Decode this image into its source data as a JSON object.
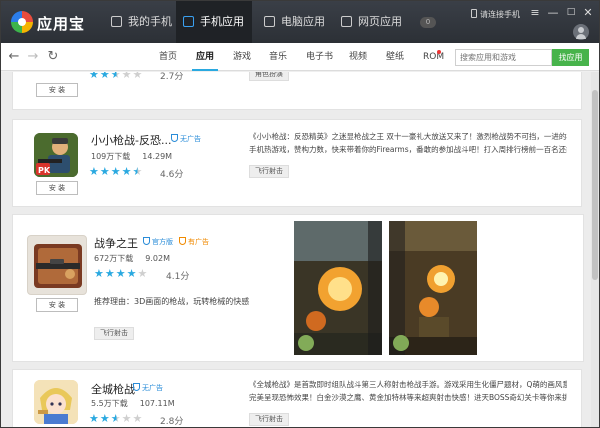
{
  "app": {
    "name": "应用宝"
  },
  "nav": {
    "tabs": [
      {
        "label": "我的手机"
      },
      {
        "label": "手机应用"
      },
      {
        "label": "电脑应用"
      },
      {
        "label": "网页应用"
      }
    ],
    "message_count": "0",
    "connect_phone": "请连接手机"
  },
  "window_buttons": {
    "menu": "≡",
    "minimize": "—",
    "maximize": "□",
    "close": "✕"
  },
  "categories": [
    "首页",
    "应用",
    "游戏",
    "音乐",
    "电子书",
    "视频",
    "壁纸",
    "ROM"
  ],
  "search": {
    "placeholder": "搜索应用和游戏",
    "button": "找应用"
  },
  "apps": [
    {
      "name": "",
      "score": "2.7分",
      "rating": 2.7,
      "install": "安 装",
      "tag": "角色扮演"
    },
    {
      "name": "小小枪战-反恐...",
      "badge": "无广告",
      "downloads": "109万下载",
      "size": "14.29M",
      "score": "4.6分",
      "rating": 4.6,
      "install": "安 装",
      "tag": "飞行射击",
      "desc_line1": "《小小枪战：反恐精英》之迷显枪战之王 双十一豪礼大放送又来了！激烈枪战势不可挡，一进的枪战",
      "desc_line2": "手机热游戏，赞构力数，快来带着你的Firearms，番敢的参加战斗吧！打入周排行榜前一百名还能赢"
    },
    {
      "name": "战争之王",
      "badge": "官方版",
      "badge2": "有广告",
      "downloads": "672万下载",
      "size": "9.02M",
      "score": "4.1分",
      "rating": 4.1,
      "install": "安 装",
      "tag": "飞行射击",
      "reason": "推荐理由：3D画面的枪战，玩转枪械的快感"
    },
    {
      "name": "全城枪战",
      "badge": "无广告",
      "downloads": "5.5万下载",
      "size": "107.11M",
      "score": "2.8分",
      "rating": 2.8,
      "install": "安 装",
      "tag": "飞行射击",
      "desc_line1": "《全城枪战》是首款即时组队战斗第三人称射击枪战手游。游戏采用生化僵尸题材，Q萌的画风意道",
      "desc_line2": "完美呈现恐怖效果！白金沙漠之鹰、黄金加特林等来超爽射击快感！进天BOSS奇幻关卡等你来挑战！难的"
    }
  ],
  "colors": {
    "accent": "#2aa9e0",
    "search_button": "#47b34b",
    "titlebar": "#2c3036"
  }
}
